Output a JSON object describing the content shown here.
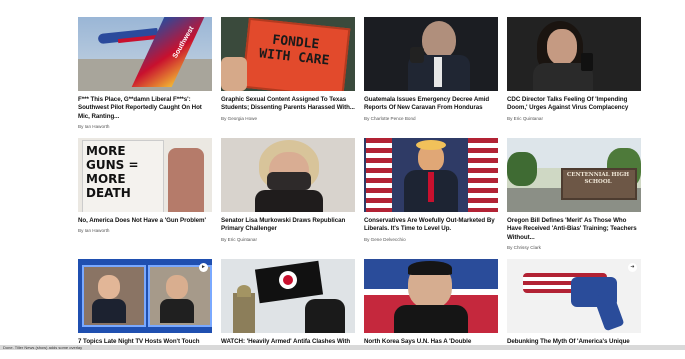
{
  "articles": [
    {
      "headline": "F*** This Place, G**damn Liberal F***s': Southwest Pilot Reportedly Caught On Hot Mic, Ranting...",
      "byline": "By Ian Haworth",
      "image": "southwest-airplane"
    },
    {
      "headline": "Graphic Sexual Content Assigned To Texas Students; Dissenting Parents Harassed With...",
      "byline": "By Georgia Howe",
      "image": "fondle-with-care-sign",
      "image_text": "FONDLE WITH CARE"
    },
    {
      "headline": "Guatemala Issues Emergency Decree Amid Reports Of New Caravan From Honduras",
      "byline": "By Charlotte Pence Bond",
      "image": "man-speaking-portrait"
    },
    {
      "headline": "CDC Director Talks Feeling Of 'Impending Doom,' Urges Against Virus Complacency",
      "byline": "By Eric Quintanar",
      "image": "woman-speaking-portrait"
    },
    {
      "headline": "No, America Does Not Have a 'Gun Problem'",
      "byline": "By Ian Haworth",
      "image": "more-guns-sign",
      "image_text": "MORE GUNS = MORE DEATH"
    },
    {
      "headline": "Senator Lisa Murkowski Draws Republican Primary Challenger",
      "byline": "By Eric Quintanar",
      "image": "woman-with-mask"
    },
    {
      "headline": "Conservatives Are Woefully Out-Marketed By Liberals. It's Time to Level Up.",
      "byline": "By Gene Delvecchio",
      "image": "man-with-flags"
    },
    {
      "headline": "Oregon Bill Defines 'Merit' As Those Who Have Received 'Anti-Bias' Training; Teachers Without...",
      "byline": "By Chrissy Clark",
      "image": "school-sign",
      "image_text": "CENTENNIAL HIGH SCHOOL"
    },
    {
      "headline": "7 Topics Late Night TV Hosts Won't Touch",
      "byline": "",
      "image": "late-night-hosts"
    },
    {
      "headline": "WATCH: 'Heavily Armed' Antifa Clashes With",
      "byline": "",
      "image": "antifa-flag"
    },
    {
      "headline": "North Korea Says U.N. Has A 'Double",
      "byline": "",
      "image": "kim-jong-un"
    },
    {
      "headline": "Debunking The Myth Of 'America's Unique",
      "byline": "",
      "image": "flag-revolver"
    }
  ],
  "status_bar": "Done. Tiller News (show) adds some overlay"
}
